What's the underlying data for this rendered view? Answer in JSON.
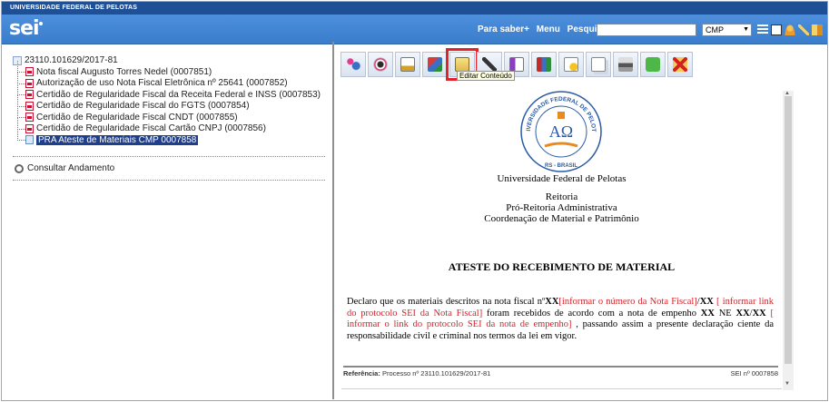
{
  "header": {
    "institution": "UNIVERSIDADE FEDERAL DE PELOTAS",
    "logo": "sei",
    "links": [
      "Para saber+",
      "Menu",
      "Pesquisa"
    ],
    "search_value": "",
    "unit_selected": "CMP",
    "icons": [
      "list-view-icon",
      "n-icon",
      "user-icon",
      "tools-icon",
      "exit-icon"
    ]
  },
  "tree": {
    "process_number": "23110.101629/2017-81",
    "items": [
      {
        "label": "Nota fiscal Augusto Torres Nedel (0007851)",
        "icon": "pdf-icon"
      },
      {
        "label": "Autorização de uso Nota Fiscal Eletrônica nº 25641 (0007852)",
        "icon": "pdf-icon"
      },
      {
        "label": "Certidão de Regularidade Fiscal da Receita Federal e INSS (0007853)",
        "icon": "pdf-icon"
      },
      {
        "label": "Certidão de Regularidade Fiscal do FGTS (0007854)",
        "icon": "pdf-icon"
      },
      {
        "label": "Certidão de Regularidade Fiscal CNDT (0007855)",
        "icon": "pdf-icon"
      },
      {
        "label": "Certidão de Regularidade Fiscal Cartão CNPJ (0007856)",
        "icon": "pdf-icon"
      },
      {
        "label": "PRA Ateste de Materiais CMP 0007858",
        "icon": "doc-icon",
        "selected": true
      }
    ],
    "consult": "Consultar Andamento"
  },
  "toolbar": {
    "icons": [
      "tramitar-icon",
      "view-icon",
      "sign-icon",
      "sign-color-icon",
      "edit-content-icon",
      "pen-icon",
      "pdf-print-icon",
      "books-icon",
      "star-doc-icon",
      "copy-icon",
      "printer-icon",
      "recycle-icon",
      "delete-icon"
    ],
    "tooltip": "Editar Conteúdo",
    "colors": {
      "highlight": "#e0232d"
    }
  },
  "document": {
    "university": "Universidade Federal de Pelotas",
    "dept_lines": [
      "Reitoria",
      "Pró-Reitoria Administrativa",
      "Coordenação de Material e Patrimônio"
    ],
    "title": "ATESTE DO RECEBIMENTO DE MATERIAL",
    "body": {
      "p1": "Declaro que os materiais descritos na nota fiscal nº",
      "b1": "XX",
      "r1": "[informar o número da Nota Fiscal]",
      "p2": "/",
      "b2": "XX",
      "r2": " [ informar link do protocolo SEI da Nota Fiscal]",
      "p3": " foram recebidos de acordo com a nota de empenho ",
      "b3": "XX",
      "p4": " NE ",
      "b4": "XX",
      "p5": "/",
      "b5": "XX",
      "r3": " [ informar o link do protocolo SEI da nota de empenho]",
      "p6": " , passando assim a presente declaração ciente da responsabilidade civil e criminal nos termos da lei em vigor."
    },
    "ref_label": "Referência:",
    "ref_text": " Processo nº 23110.101629/2017-81",
    "sei_number": "SEI nº 0007858",
    "seal_text": "UNIVERSIDADE FEDERAL DE PELOTAS",
    "seal_bottom": "RS - BRASIL"
  }
}
